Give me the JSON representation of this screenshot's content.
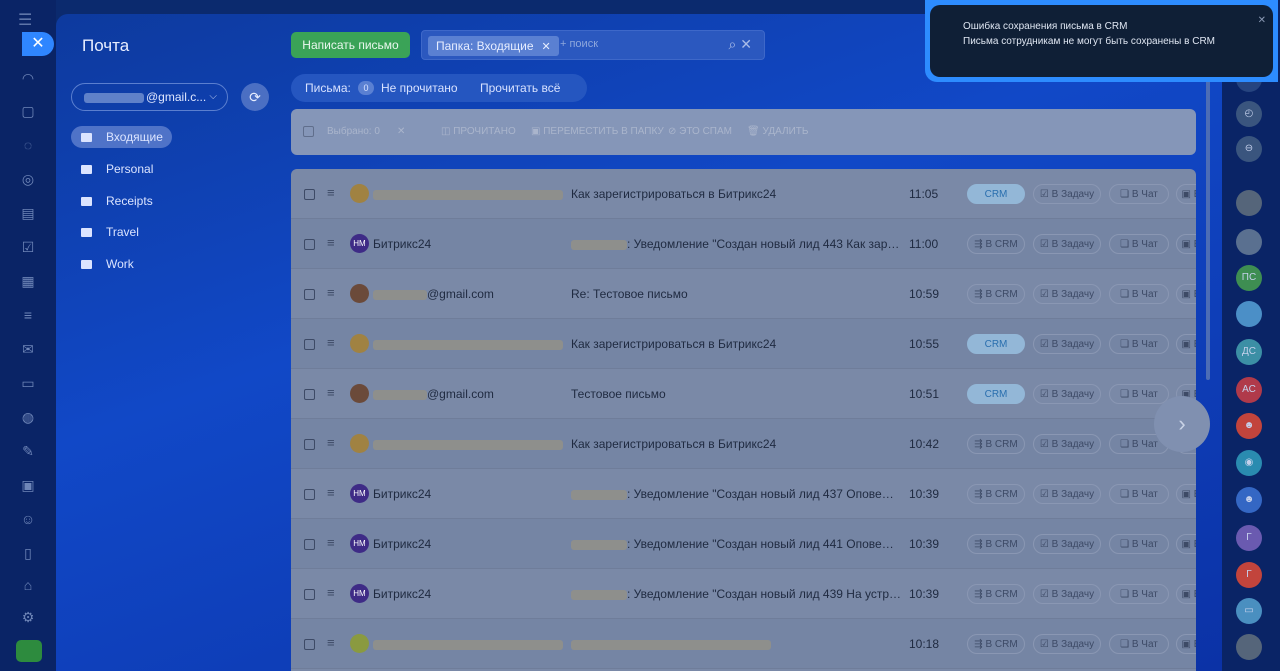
{
  "sidebar": {
    "title": "Почта",
    "account_suffix": "@gmail.c...",
    "folders": [
      {
        "label": "Входящие"
      },
      {
        "label": "Personal"
      },
      {
        "label": "Receipts"
      },
      {
        "label": "Travel"
      },
      {
        "label": "Work"
      }
    ]
  },
  "header": {
    "write_label": "Написать письмо",
    "filter_chip": "Папка: Входящие",
    "search_placeholder": "+ поиск"
  },
  "counters": {
    "letters_label": "Письма:",
    "unread_count": "0",
    "unread_label": "Не прочитано",
    "read_all_label": "Прочитать всё"
  },
  "toolbar": {
    "selected_label": "Выбрано: 0",
    "read_label": "ПРОЧИТАНО",
    "move_label": "ПЕРЕМЕСТИТЬ В ПАПКУ",
    "spam_label": "ЭТО СПАМ",
    "delete_label": "УДАЛИТЬ"
  },
  "row_actions": {
    "crm": "CRM",
    "to_crm": "В CRM",
    "to_task": "В Задачу",
    "to_chat": "В Чат",
    "more": "В"
  },
  "messages": [
    {
      "avatar": "",
      "from": "",
      "subject": "Как зарегистрироваться в Битрикс24",
      "time": "11:05",
      "crm_saved": true
    },
    {
      "avatar": "НМ",
      "from": "Битрикс24",
      "subject": ": Уведомление \"Создан новый лид 443 Как зареги...",
      "time": "11:00",
      "crm_saved": false
    },
    {
      "avatar": "",
      "from": "@gmail.com",
      "subject": "Re: Тестовое письмо",
      "time": "10:59",
      "crm_saved": false
    },
    {
      "avatar": "",
      "from": "",
      "subject": "Как зарегистрироваться в Битрикс24",
      "time": "10:55",
      "crm_saved": true
    },
    {
      "avatar": "",
      "from": "@gmail.com",
      "subject": "Тестовое письмо",
      "time": "10:51",
      "crm_saved": true
    },
    {
      "avatar": "",
      "from": "",
      "subject": "Как зарегистрироваться в Битрикс24",
      "time": "10:42",
      "crm_saved": false
    },
    {
      "avatar": "НМ",
      "from": "Битрикс24",
      "subject": ": Уведомление \"Создан новый лид 437 Оповещен...",
      "time": "10:39",
      "crm_saved": false
    },
    {
      "avatar": "НМ",
      "from": "Битрикс24",
      "subject": ": Уведомление \"Создан новый лид 441 Оповещен...",
      "time": "10:39",
      "crm_saved": false
    },
    {
      "avatar": "НМ",
      "from": "Битрикс24",
      "subject": ": Уведомление \"Создан новый лид 439 На устрой...",
      "time": "10:39",
      "crm_saved": false
    },
    {
      "avatar": "",
      "from": "",
      "subject": "",
      "time": "10:18",
      "crm_saved": false
    }
  ],
  "notification": {
    "line1": "Ошибка сохранения письма в CRM",
    "line2": "Письма сотрудникам не могут быть сохранены в CRM"
  },
  "right_rail": {
    "avatars": [
      "ПС",
      "ДС",
      "АС",
      "Г",
      "Г"
    ]
  }
}
